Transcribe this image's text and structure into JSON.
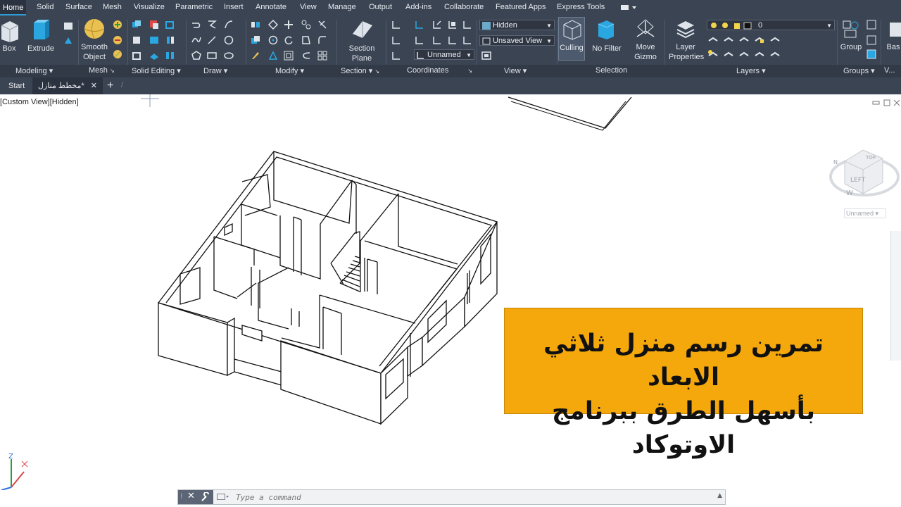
{
  "menu": [
    "Home",
    "Solid",
    "Surface",
    "Mesh",
    "Visualize",
    "Parametric",
    "Insert",
    "Annotate",
    "View",
    "Manage",
    "Output",
    "Add-ins",
    "Collaborate",
    "Featured Apps",
    "Express Tools"
  ],
  "ribbon": {
    "box": "Box",
    "extrude": "Extrude",
    "smooth_object": "Smooth\nObject",
    "section_plane": "Section\nPlane",
    "culling": "Culling",
    "no_filter": "No Filter",
    "move_gizmo": "Move\nGizmo",
    "layer_properties": "Layer\nProperties",
    "group": "Group",
    "base_cut": "Bas",
    "visual_style": "Hidden",
    "saved_view": "Unsaved View",
    "ucs": "Unnamed",
    "layer_value": "0",
    "panels": [
      "Modeling",
      "Mesh",
      "Solid Editing",
      "Draw",
      "Modify",
      "Section",
      "Coordinates",
      "View",
      "Selection",
      "Layers",
      "Groups",
      "V..."
    ]
  },
  "tabs": {
    "start": "Start",
    "drawing": "مخطط منازل*"
  },
  "viewport": {
    "label": "[Custom View][Hidden]",
    "viewcube_face": "LEFT",
    "viewcube_top": "TOP",
    "compass_w": "W",
    "compass_n": "N",
    "ucs_badge": "Unnamed"
  },
  "banner": {
    "line1": "تمرين رسم منزل ثلاثي الابعاد",
    "line2": "بأسهل الطرق  ببرنامج الاوتوكاد"
  },
  "command": {
    "placeholder": "Type a command"
  },
  "colors": {
    "ribbon_bg": "#3b4453",
    "accent": "#2f9cd8",
    "banner": "#f5a80c"
  }
}
